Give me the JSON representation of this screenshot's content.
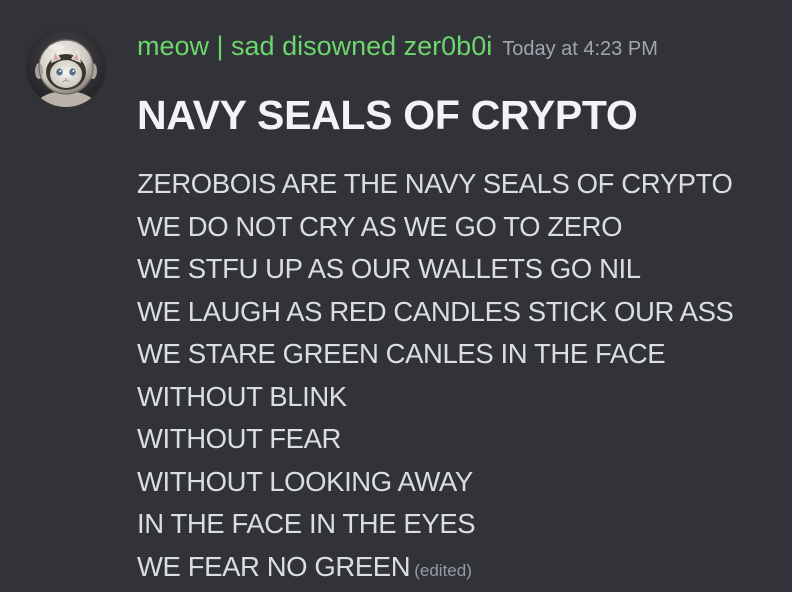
{
  "message": {
    "author": {
      "display_name": "meow | sad disowned zer0b0i",
      "name_color": "#6dd56d",
      "avatar_icon": "cat-astronaut-avatar"
    },
    "timestamp": "Today at 4:23 PM",
    "heading": "NAVY SEALS OF CRYPTO",
    "body_lines": [
      "ZEROBOIS ARE THE NAVY SEALS OF CRYPTO",
      "WE DO NOT CRY AS WE GO TO ZERO",
      "WE STFU UP AS OUR WALLETS GO NIL",
      "WE LAUGH AS RED CANDLES STICK OUR ASS",
      "WE STARE GREEN CANLES IN THE FACE",
      "WITHOUT BLINK",
      "WITHOUT FEAR",
      "WITHOUT LOOKING AWAY",
      "IN THE FACE IN THE EYES",
      "WE FEAR NO GREEN"
    ],
    "edited_label": "(edited)"
  },
  "colors": {
    "background": "#313338",
    "text": "#dbdee1",
    "heading": "#f2f3f5",
    "muted": "#a3a6ae"
  }
}
